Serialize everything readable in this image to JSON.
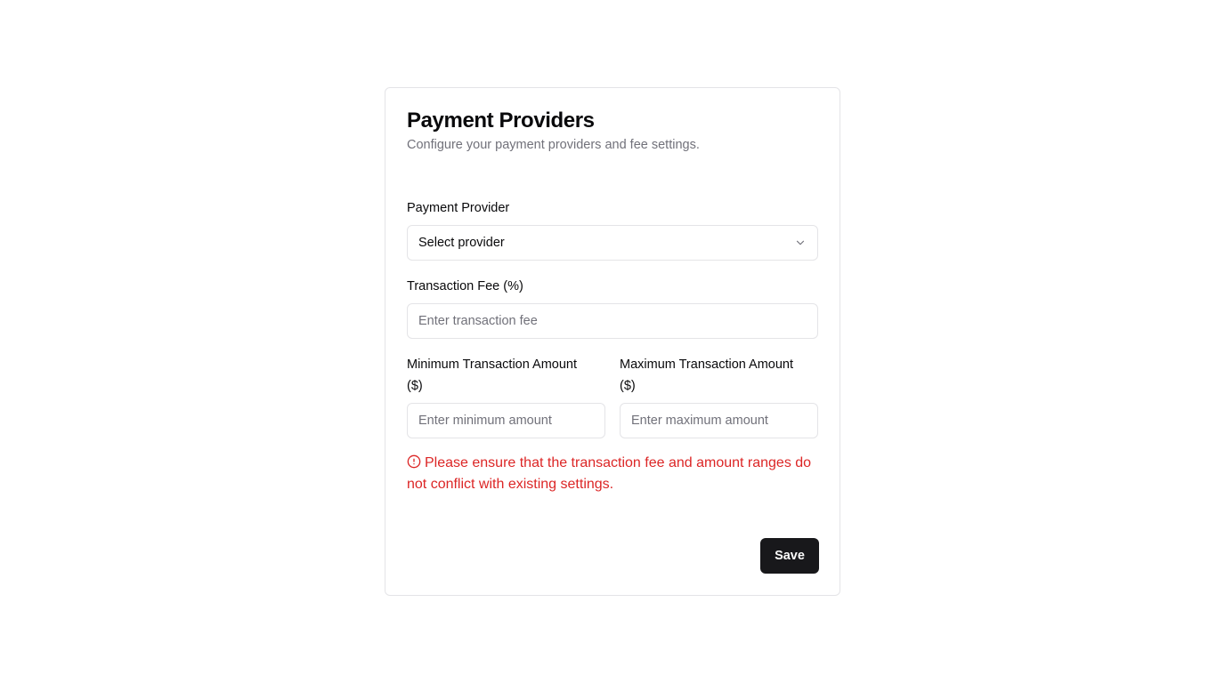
{
  "card": {
    "title": "Payment Providers",
    "subtitle": "Configure your payment providers and fee settings."
  },
  "provider": {
    "label": "Payment Provider",
    "value": "Select provider",
    "icon": "chevron-down-icon"
  },
  "fee": {
    "label": "Transaction Fee (%)",
    "placeholder": "Enter transaction fee",
    "value": ""
  },
  "min_amount": {
    "label_line1": "Minimum Transaction Amount",
    "label_line2": "($)",
    "placeholder": "Enter minimum amount",
    "value": ""
  },
  "max_amount": {
    "label_line1": "Maximum Transaction Amount",
    "label_line2": "($)",
    "placeholder": "Enter maximum amount",
    "value": ""
  },
  "error": {
    "icon": "alert-circle-icon",
    "message": "Please ensure that the transaction fee and amount ranges do not conflict with existing settings.",
    "color": "#dc2626"
  },
  "actions": {
    "save_label": "Save"
  },
  "theme": {
    "primary": "#18181b",
    "border": "#e4e4e7",
    "muted_text": "#71717a"
  }
}
